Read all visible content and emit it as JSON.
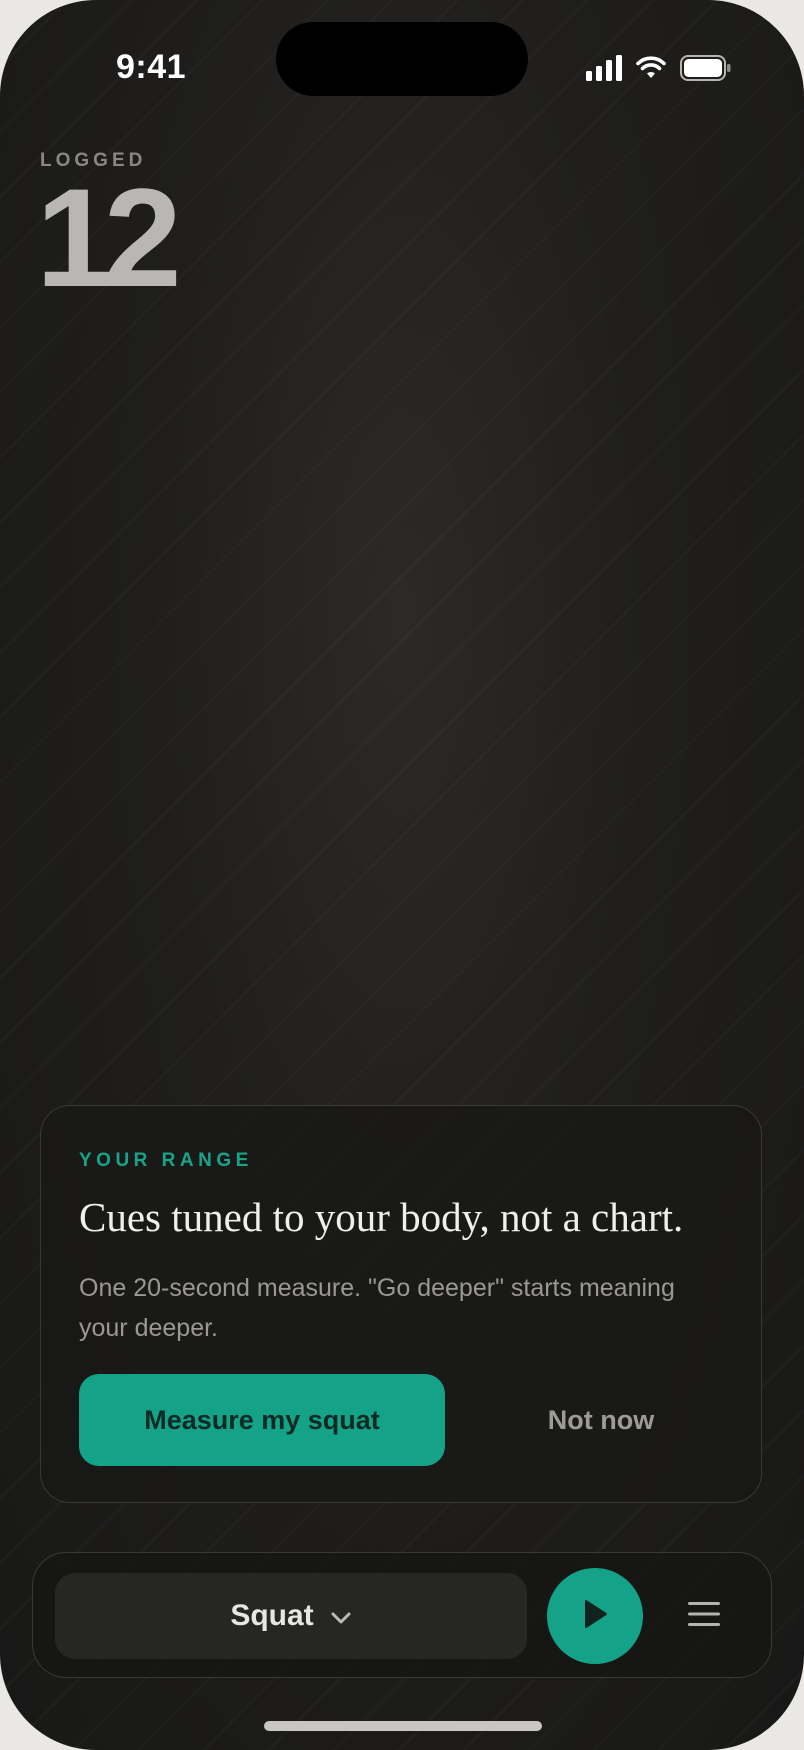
{
  "status_bar": {
    "time": "9:41",
    "icons": [
      "cellular-signal-icon",
      "wifi-icon",
      "battery-icon"
    ]
  },
  "logged": {
    "label": "LOGGED",
    "value": "12"
  },
  "range_card": {
    "eyebrow": "YOUR RANGE",
    "title": "Cues tuned to your body, not a chart.",
    "body": "One 20-second measure. \"Go deeper\" starts meaning your deeper.",
    "primary_button": "Measure my squat",
    "secondary_button": "Not now"
  },
  "bottom_bar": {
    "exercise": "Squat",
    "exercise_icon": "chevron-down-icon",
    "play_icon": "play-icon",
    "menu_icon": "menu-icon"
  },
  "colors": {
    "accent": "#14a388",
    "background": "#1f1e1c",
    "text_primary": "#f1efe9",
    "text_muted": "#9b9893"
  }
}
